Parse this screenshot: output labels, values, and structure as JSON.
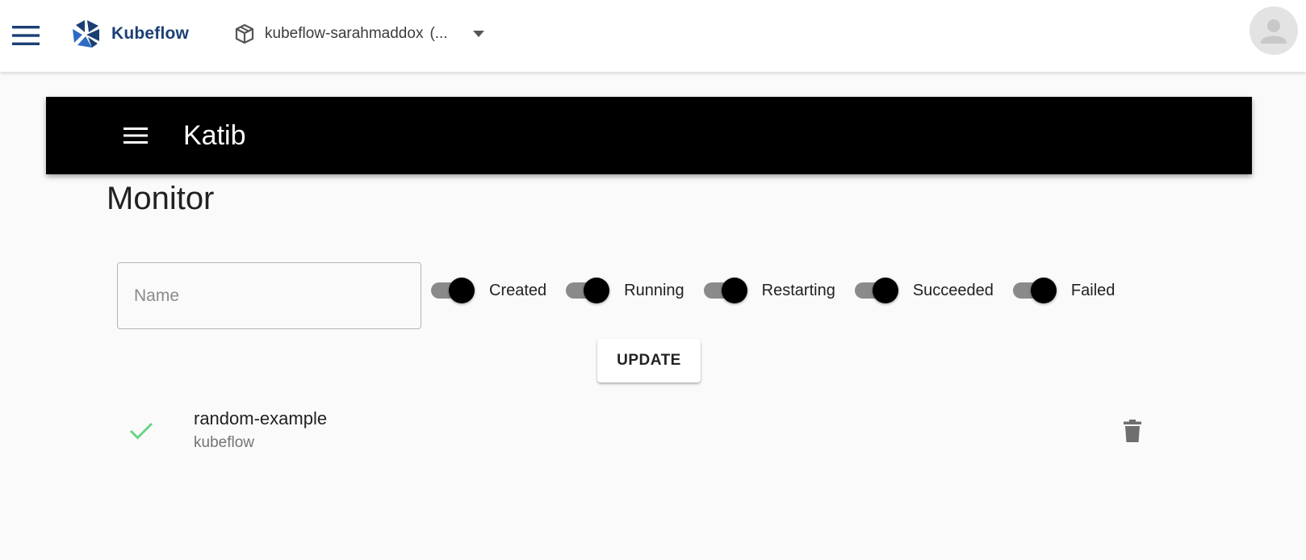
{
  "topbar": {
    "logo_text": "Kubeflow",
    "namespace": "kubeflow-sarahmaddox",
    "namespace_ellipsis": "(..."
  },
  "katib": {
    "title": "Katib"
  },
  "monitor": {
    "title": "Monitor",
    "name_placeholder": "Name",
    "name_value": "",
    "filters": [
      {
        "label": "Created",
        "on": true
      },
      {
        "label": "Running",
        "on": true
      },
      {
        "label": "Restarting",
        "on": true
      },
      {
        "label": "Succeeded",
        "on": true
      },
      {
        "label": "Failed",
        "on": true
      }
    ],
    "update_label": "UPDATE"
  },
  "experiments": [
    {
      "name": "random-example",
      "namespace": "kubeflow",
      "status": "succeeded",
      "status_color": "#69d388"
    }
  ],
  "colors": {
    "brand": "#1b3f74",
    "katib_bar": "#000000",
    "toggle_thumb": "#000000",
    "toggle_track": "#8a8a8a",
    "success": "#69d388"
  },
  "icons": {
    "menu": "menu-icon",
    "logo": "kubeflow-logo-icon",
    "namespace": "cube-icon",
    "dropdown": "chevron-down-icon",
    "avatar": "user-avatar-icon",
    "status": "check-icon",
    "delete": "trash-icon"
  }
}
